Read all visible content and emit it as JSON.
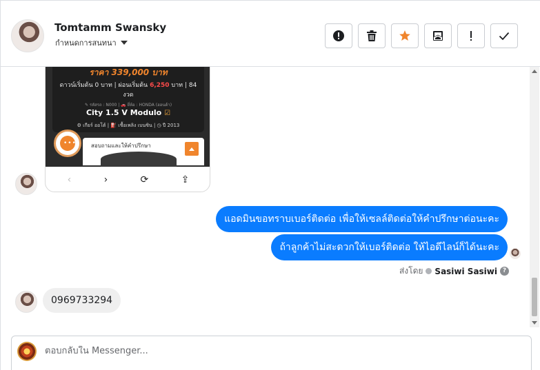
{
  "contact": {
    "name": "Tomtamm Swansky",
    "assign_label": "กำหนดการสนทนา"
  },
  "toolbar": {
    "buttons": [
      {
        "name": "alert-circle-icon",
        "label": "Mark as spam"
      },
      {
        "name": "trash-icon",
        "label": "Delete"
      },
      {
        "name": "star-icon",
        "label": "Star"
      },
      {
        "name": "inbox-icon",
        "label": "Move to inbox"
      },
      {
        "name": "exclamation-icon",
        "label": "Follow up"
      },
      {
        "name": "check-icon",
        "label": "Done"
      }
    ],
    "star_color": "#f0852d"
  },
  "shared_image": {
    "price": "ราคา 339,000 บาท",
    "down_prefix": "ดาวน์เริ่มต้น 0 บาท | ผ่อนเริ่มต้น ",
    "down_amount": "6,250",
    "down_suffix": " บาท | 84",
    "down_line2": "งวด",
    "meta1": "✎ รหัสรถ : N000 | 🚗 ยี่ห้อ : HONDA (ฮอนด้า)",
    "model": "City 1.5 V Modulo",
    "meta2": "⚙ เกียร์ ออโต้ | ⛽ เชื้อเพลิง เบนซิน | ◷ ปี 2013",
    "ask": "สอบถามและให้คำปรึกษา"
  },
  "messages": {
    "outgoing_1": "แอดมินขอทราบเบอร์ติดต่อ เพื่อให้เซลล์ติดต่อให้คำปรึกษาต่อนะคะ",
    "outgoing_2": "ถ้าลูกค้าไม่สะดวกให้เบอร์ติดต่อ ให้ไอดีไลน์ก็ได้นะคะ",
    "sent_by_label": "ส่งโดย",
    "sender_name": "Sasiwi Sasiwi",
    "incoming_phone": "0969733294"
  },
  "composer": {
    "placeholder": "ตอบกลับใน Messenger..."
  },
  "colors": {
    "accent": "#0a7cff",
    "incoming_bubble": "#efefef"
  }
}
